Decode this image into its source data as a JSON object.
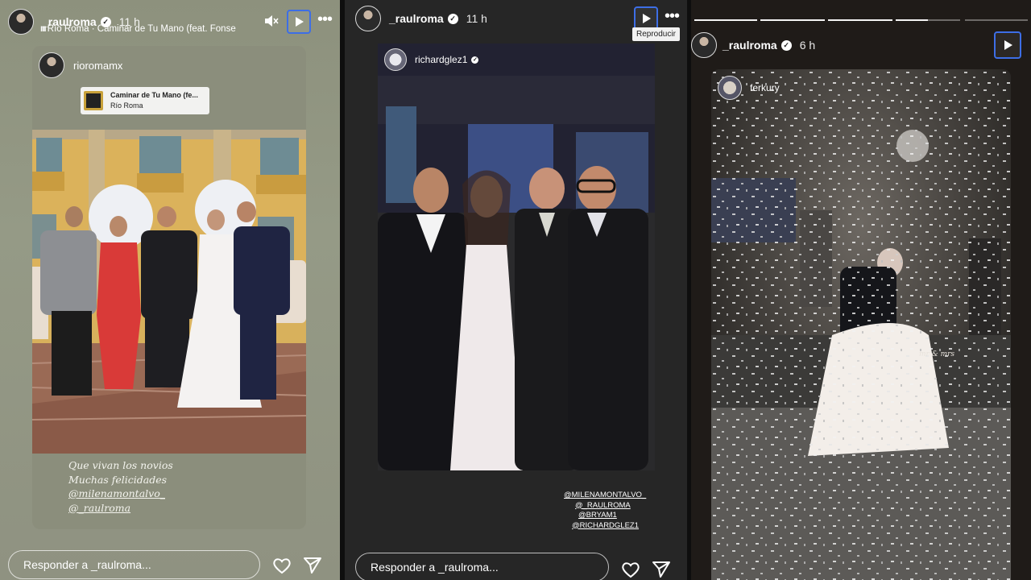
{
  "story1": {
    "username": "_raulroma",
    "time": "11 h",
    "song_line": "Río Roma · Caminar de Tu Mano (feat. Fonse",
    "repost_username": "rioromamx",
    "music_sticker": {
      "title": "Caminar de Tu Mano (fe...",
      "artist": "Río Roma"
    },
    "caption_lines": [
      "Que vivan los novios",
      "Muchas felicidades",
      "@milenamontalvo_",
      "@_raulroma"
    ],
    "reply_placeholder": "Responder a _raulroma..."
  },
  "story2": {
    "username": "_raulroma",
    "time": "11 h",
    "tooltip": "Reproducir",
    "repost_username": "richardglez1",
    "mentions": [
      "@MILENAMONTALVO_",
      "@_RAULROMA",
      "@BRYAM1",
      "@RICHARDGLEZ1"
    ],
    "reply_placeholder": "Responder a _raulroma..."
  },
  "story3": {
    "username": "_raulroma",
    "time": "6 h",
    "repost_username": "ferkury",
    "overlay_text": "mr & mrs",
    "reply_placeholder": "Responder a _raulroma..."
  },
  "icons": {
    "verified": "verified-badge-icon",
    "play": "play-icon",
    "more": "more-options-icon",
    "mute": "muted-speaker-icon",
    "heart": "heart-icon",
    "send": "send-icon"
  },
  "colors": {
    "focus_ring": "#3d6ee6",
    "panel1_bg": "#8f9281",
    "panel2_bg": "#262626",
    "panel3_bg": "#1f1b18"
  }
}
